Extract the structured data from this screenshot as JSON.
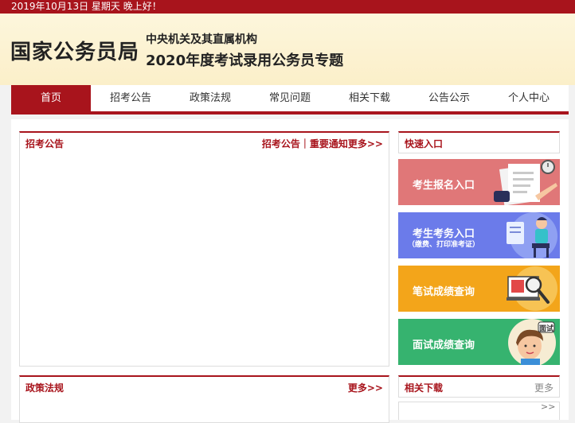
{
  "topbar": {
    "date_text": "2019年10月13日   星期天   晚上好！"
  },
  "header": {
    "site_name": "国家公务员局",
    "subtitle1": "中央机关及其直属机构",
    "subtitle2": "2020年度考试录用公务员专题"
  },
  "nav": {
    "items": [
      {
        "label": "首页"
      },
      {
        "label": "招考公告"
      },
      {
        "label": "政策法规"
      },
      {
        "label": "常见问题"
      },
      {
        "label": "相关下载"
      },
      {
        "label": "公告公示"
      },
      {
        "label": "个人中心"
      }
    ]
  },
  "panels": {
    "notice": {
      "title": "招考公告",
      "more": "招考公告｜重要通知更多>>"
    },
    "policy": {
      "title": "政策法规",
      "more": "更多>>"
    },
    "quick": {
      "title": "快速入口"
    },
    "download": {
      "title": "相关下载",
      "more": "更多"
    }
  },
  "quick_entries": [
    {
      "label": "考生报名入口",
      "icon": "document-pen-icon"
    },
    {
      "label": "考生考务入口",
      "sub": "（缴费、打印准考证）",
      "icon": "person-computer-icon"
    },
    {
      "label": "笔试成绩查询",
      "icon": "magnifier-screen-icon"
    },
    {
      "label": "面试成绩查询",
      "icon": "interview-person-icon",
      "badge": "面试"
    }
  ],
  "footer": {
    "arrows": ">>"
  },
  "colors": {
    "brand_red": "#a8141c",
    "entry1": "#e07778",
    "entry2": "#6b7bea",
    "entry3": "#f3a51a",
    "entry4": "#36b36f"
  }
}
